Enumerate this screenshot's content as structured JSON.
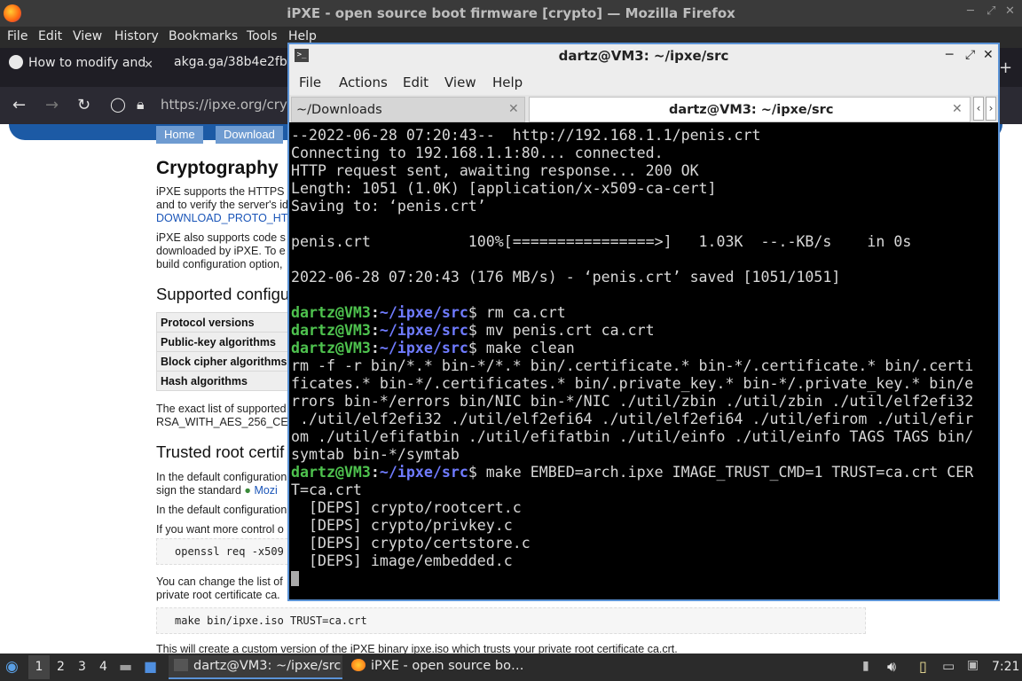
{
  "firefox": {
    "window_title": "iPXE - open source boot firmware [crypto] — Mozilla Firefox",
    "menu": [
      "File",
      "Edit",
      "View",
      "History",
      "Bookmarks",
      "Tools",
      "Help"
    ],
    "tabs": [
      {
        "label": "How to modify and",
        "icon": "github-icon"
      },
      {
        "label": "akga.ga/38b4e2fb.",
        "icon": "page-icon"
      }
    ],
    "url": "https://ipxe.org/cryp"
  },
  "page": {
    "nav": [
      "Home",
      "Download"
    ],
    "title": "Cryptography",
    "para1": [
      "iPXE supports the HTTPS",
      "and to verify the server's id",
      "DOWNLOAD_PROTO_HT"
    ],
    "para2": [
      "iPXE also supports code s",
      "downloaded by iPXE. To e",
      "build configuration option,"
    ],
    "h_supported": "Supported configu",
    "table_rows": [
      "Protocol versions",
      "Public-key algorithms",
      "Block cipher algorithms",
      "Hash algorithms"
    ],
    "para3": [
      "The exact list of supported",
      "RSA_WITH_AES_256_CE"
    ],
    "h_trusted": "Trusted root certif",
    "para4": [
      "In the default configuration",
      "sign the standard"
    ],
    "mozilla_link": "Mozi",
    "para5": "In the default configuration",
    "para6": "If you want more control o",
    "code1": "openssl req -x509 -",
    "para7": [
      "You can change the list of",
      "private root certificate ca."
    ],
    "code2": "make bin/ipxe.iso TRUST=ca.crt",
    "para8": "This will create a custom version of the iPXE binary ipxe.iso which trusts your private root certificate ca.crt."
  },
  "terminal": {
    "title": "dartz@VM3: ~/ipxe/src",
    "menu": [
      "File",
      "Actions",
      "Edit",
      "View",
      "Help"
    ],
    "tabs": [
      "~/Downloads",
      "dartz@VM3: ~/ipxe/src"
    ],
    "lines": [
      {
        "text": "--2022-06-28 07:20:43--  http://192.168.1.1/penis.crt"
      },
      {
        "text": "Connecting to 192.168.1.1:80... connected."
      },
      {
        "text": "HTTP request sent, awaiting response... 200 OK"
      },
      {
        "text": "Length: 1051 (1.0K) [application/x-x509-ca-cert]"
      },
      {
        "text": "Saving to: ‘penis.crt’"
      },
      {
        "text": ""
      },
      {
        "text": "penis.crt           100%[================>]   1.03K  --.-KB/s    in 0s"
      },
      {
        "text": ""
      },
      {
        "text": "2022-06-28 07:20:43 (176 MB/s) - ‘penis.crt’ saved [1051/1051]"
      },
      {
        "text": ""
      },
      {
        "user": "dartz@VM3",
        "path": "~/ipxe/src",
        "cmd": "rm ca.crt"
      },
      {
        "user": "dartz@VM3",
        "path": "~/ipxe/src",
        "cmd": "mv penis.crt ca.crt"
      },
      {
        "user": "dartz@VM3",
        "path": "~/ipxe/src",
        "cmd": "make clean"
      },
      {
        "text": "rm -f -r bin/*.* bin-*/*.* bin/.certificate.* bin-*/.certificate.* bin/.certi"
      },
      {
        "text": "ficates.* bin-*/.certificates.* bin/.private_key.* bin-*/.private_key.* bin/e"
      },
      {
        "text": "rrors bin-*/errors bin/NIC bin-*/NIC ./util/zbin ./util/zbin ./util/elf2efi32"
      },
      {
        "text": " ./util/elf2efi32 ./util/elf2efi64 ./util/elf2efi64 ./util/efirom ./util/efir"
      },
      {
        "text": "om ./util/efifatbin ./util/efifatbin ./util/einfo ./util/einfo TAGS TAGS bin/"
      },
      {
        "text": "symtab bin-*/symtab"
      },
      {
        "user": "dartz@VM3",
        "path": "~/ipxe/src",
        "cmd": "make EMBED=arch.ipxe IMAGE_TRUST_CMD=1 TRUST=ca.crt CER"
      },
      {
        "text": "T=ca.crt"
      },
      {
        "text": "  [DEPS] crypto/rootcert.c"
      },
      {
        "text": "  [DEPS] crypto/privkey.c"
      },
      {
        "text": "  [DEPS] crypto/certstore.c"
      },
      {
        "text": "  [DEPS] image/embedded.c"
      },
      {
        "text": ""
      }
    ]
  },
  "taskbar": {
    "workspaces": [
      "1",
      "2",
      "3",
      "4"
    ],
    "tasks": [
      "dartz@VM3: ~/ipxe/src",
      "iPXE - open source bo…"
    ],
    "clock": "7:21"
  }
}
